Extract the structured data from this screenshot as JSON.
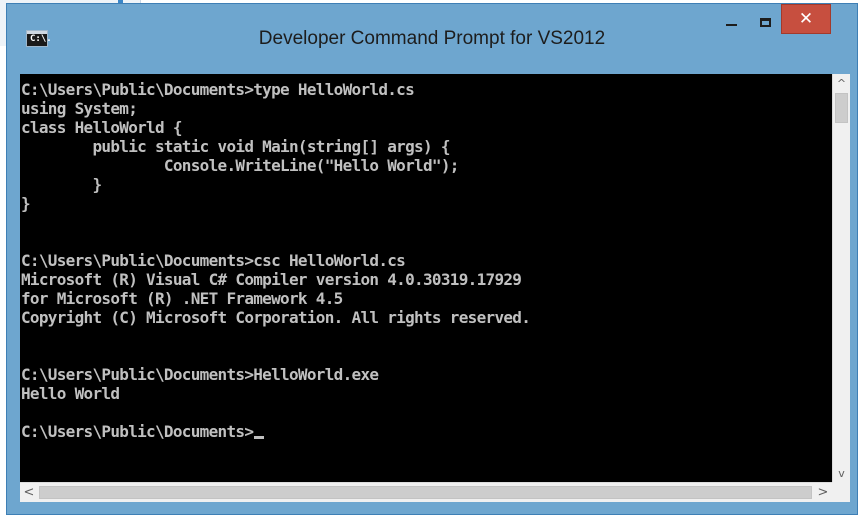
{
  "window": {
    "title": "Developer Command Prompt for VS2012",
    "icon": "console-app-icon",
    "icon_text": "C:\\.",
    "controls": {
      "minimize": "minimize-icon",
      "maximize": "maximize-icon",
      "close_glyph": "✕"
    }
  },
  "console": {
    "lines": [
      "C:\\Users\\Public\\Documents>type HelloWorld.cs",
      "using System;",
      "class HelloWorld {",
      "        public static void Main(string[] args) {",
      "                Console.WriteLine(\"Hello World\");",
      "        }",
      "}",
      "",
      "",
      "C:\\Users\\Public\\Documents>csc HelloWorld.cs",
      "Microsoft (R) Visual C# Compiler version 4.0.30319.17929",
      "for Microsoft (R) .NET Framework 4.5",
      "Copyright (C) Microsoft Corporation. All rights reserved.",
      "",
      "",
      "C:\\Users\\Public\\Documents>HelloWorld.exe",
      "Hello World",
      "",
      "C:\\Users\\Public\\Documents>"
    ],
    "text_color": "#c0c0c0",
    "background": "#000000"
  },
  "scrollbars": {
    "up_glyph": "^",
    "down_glyph": "v",
    "left_glyph": "<",
    "right_glyph": ">"
  },
  "colors": {
    "frame": "#6ea6cf",
    "close_button": "#c74f3f"
  }
}
